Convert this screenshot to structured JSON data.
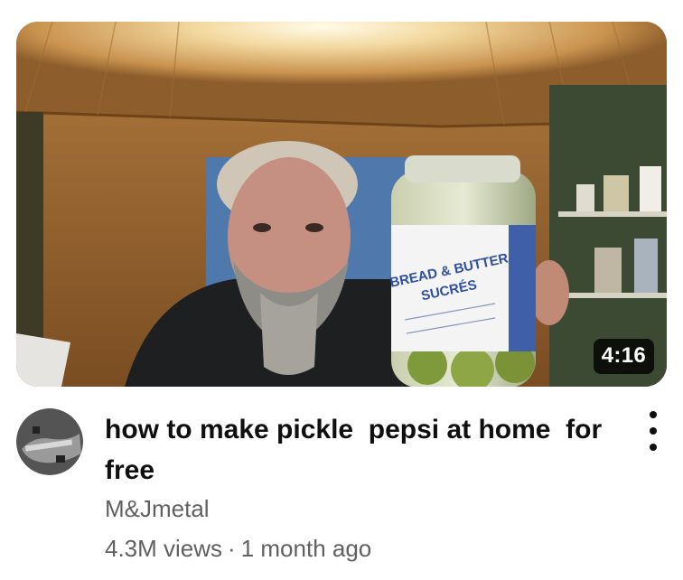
{
  "video": {
    "duration": "4:16",
    "jar_label_line1": "BREAD & BUTTER",
    "jar_label_line2": "SUCRÉS",
    "title": "how to make pickle  pepsi at home  for free",
    "channel": "M&Jmetal",
    "views": "4.3M views",
    "separator": "·",
    "age": "1 month ago"
  },
  "icons": {
    "menu": "more-vertical-icon"
  }
}
